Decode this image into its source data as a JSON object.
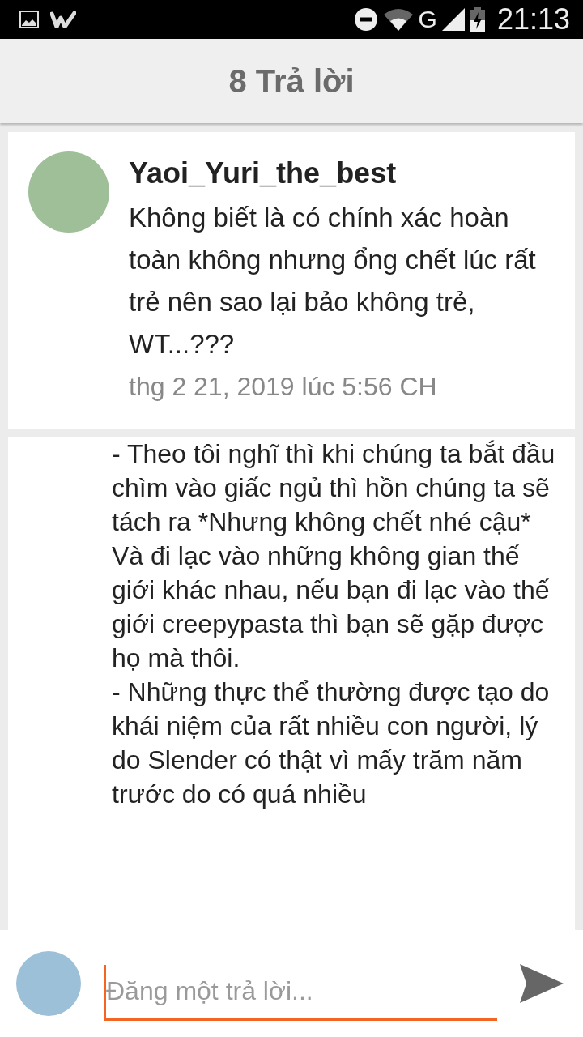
{
  "status_bar": {
    "network": "G",
    "time": "21:13"
  },
  "header": {
    "title": "8 Trả lời"
  },
  "comment": {
    "author": "Yaoi_Yuri_the_best",
    "text": "Không biết là có chính xác hoàn toàn không nhưng ổng chết lúc rất trẻ nên sao lại bảo không trẻ, WT...???",
    "date": "thg 2 21, 2019 lúc 5:56 CH"
  },
  "reply": {
    "paragraphs": [
      "- Theo tôi nghĩ thì khi chúng ta bắt đầu chìm vào giấc ngủ thì hồn chúng ta sẽ tách ra *Nhưng không chết nhé cậu*",
      "Và đi lạc vào những không gian thế giới khác nhau, nếu bạn đi lạc vào thế giới creepypasta thì bạn sẽ gặp được họ mà thôi.",
      "- Những thực thể thường được tạo do khái niệm của rất nhiều con người, lý do Slender có thật vì mấy trăm năm trước do có quá nhiều"
    ]
  },
  "composer": {
    "placeholder": "Đăng một trả lời..."
  }
}
